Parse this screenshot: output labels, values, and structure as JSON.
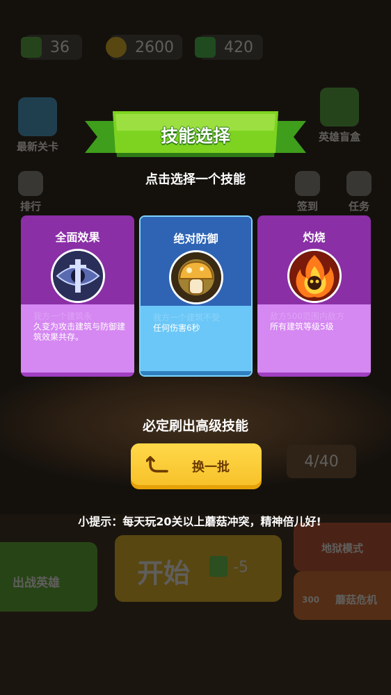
{
  "resources": [
    {
      "icon": "energy-icon",
      "value": "36",
      "color": "#4caf3a"
    },
    {
      "icon": "coin-icon",
      "value": "2600",
      "color": "#e8b81a"
    },
    {
      "icon": "gem-icon",
      "value": "420",
      "color": "#3cc24a"
    }
  ],
  "menu": {
    "latest_level": "最新关卡",
    "hero_blindbox": "英雄盲盒",
    "ranking": "排行",
    "signin": "签到",
    "tasks": "任务"
  },
  "modal": {
    "title": "技能选择",
    "subtitle": "点击选择一个技能",
    "cards": [
      {
        "name": "全面效果",
        "desc_faded": "我方一个建筑永",
        "desc": "久变为攻击建筑与防御建筑效果共存。",
        "icon": "eye-sword-icon"
      },
      {
        "name": "绝对防御",
        "desc_faded": "我方一个建筑不受",
        "desc": "任何伤害6秒",
        "icon": "mushroom-shield-icon"
      },
      {
        "name": "灼烧",
        "desc_faded": "敌方500范围内敌方",
        "desc": "所有建筑等级5级",
        "icon": "fire-icon"
      }
    ],
    "guarantee": "必定刷出高级技能",
    "refresh_label": "换一批",
    "tip": "小提示：每天玩20关以上蘑菇冲突，精神倍儿好!"
  },
  "background": {
    "deploy_heroes": "出战英雄",
    "start": "开始",
    "start_cost": "-5",
    "progress": "4/40",
    "hell_mode": "地狱模式",
    "mushroom_crisis": "蘑菇危机",
    "crisis_cost": "300"
  }
}
